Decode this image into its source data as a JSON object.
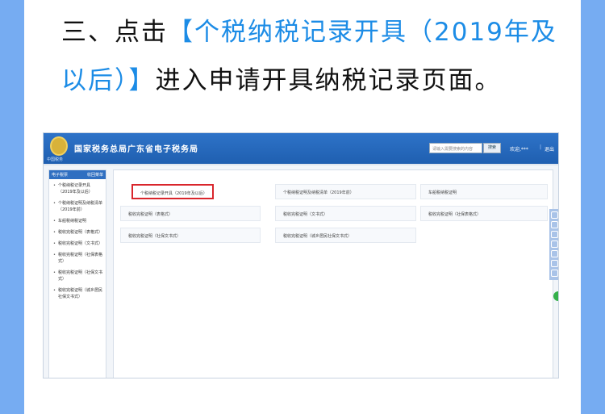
{
  "instruction": {
    "line1_prefix": "三、点击",
    "line1_highlight": "【个税纳税记录开具（2019年及",
    "line2_highlight": "以后）】",
    "line2_suffix": "进入申请开具纳税记录页面。"
  },
  "colors": {
    "accent": "#1c8ce6",
    "topbar": "#2668bd",
    "active_border": "#d9262c",
    "page_bg": "#6ea7f0"
  },
  "portal": {
    "emblem_caption": "中国税务",
    "site_title": "国家税务总局广东省电子税务局",
    "search_placeholder": "请输入需要搜索的内容",
    "search_button": "搜索",
    "user_name": "欢迎,",
    "user_masked": "***",
    "separator": "|",
    "logout": "退出"
  },
  "sidebar": {
    "header": "电子税票",
    "header_right": "收回菜单",
    "items": [
      {
        "label": "个税纳税记录开具（2019年及以后）"
      },
      {
        "label": "个税纳税证明及纳税清单（2019年前）"
      },
      {
        "label": "车船税纳税证明"
      },
      {
        "label": "税收完税证明（表格式）"
      },
      {
        "label": "税收完税证明（文书式）"
      },
      {
        "label": "税收完税证明（社保表格式）"
      },
      {
        "label": "税收完税证明（社保文书式）"
      },
      {
        "label": "税收完税证明（城乡居民社保文书式）"
      }
    ]
  },
  "tiles": [
    {
      "label": "个税纳税记录开具（2019年及以后）",
      "active": true
    },
    {
      "label": "个税纳税证明及纳税清单（2019年前）",
      "active": false
    },
    {
      "label": "车船税纳税证明",
      "active": false
    },
    {
      "label": "税收完税证明（表格式）",
      "active": false
    },
    {
      "label": "税收完税证明（文书式）",
      "active": false
    },
    {
      "label": "税收完税证明（社保表格式）",
      "active": false
    },
    {
      "label": "税收完税证明（社保文书式）",
      "active": false
    },
    {
      "label": "税收完税证明（城乡居民社保文书式）",
      "active": false
    }
  ],
  "float_toolbar": {
    "icons": [
      "phone-icon",
      "chat-icon",
      "qr-icon",
      "edit-icon",
      "doc-icon",
      "feedback-icon",
      "up-arrow-icon"
    ]
  }
}
